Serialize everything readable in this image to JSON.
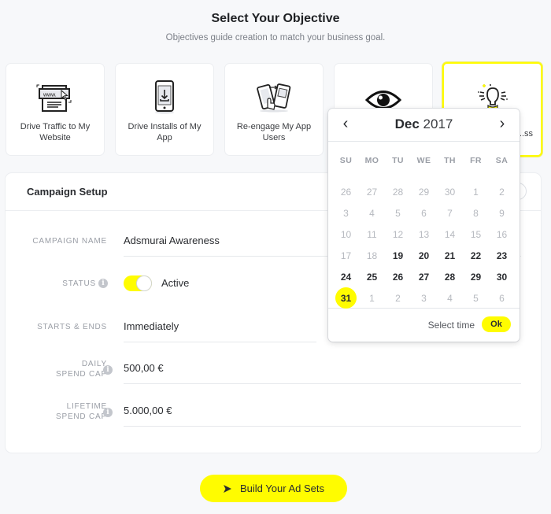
{
  "header": {
    "title": "Select Your Objective",
    "subtitle": "Objectives guide creation to match your business goal."
  },
  "objectives": [
    {
      "label": "Drive Traffic to My Website",
      "icon": "website-icon",
      "selected": false
    },
    {
      "label": "Drive Installs of My App",
      "icon": "app-install-icon",
      "selected": false
    },
    {
      "label": "Re-engage My App Users",
      "icon": "app-reengage-icon",
      "selected": false
    },
    {
      "label": "",
      "icon": "eye-icon",
      "selected": false
    },
    {
      "label": "...ss",
      "icon": "awareness-icon",
      "selected": true
    }
  ],
  "campaign_setup": {
    "title": "Campaign Setup",
    "fields": {
      "campaign_name": {
        "label": "CAMPAIGN NAME",
        "value": "Adsmurai Awareness"
      },
      "status": {
        "label": "STATUS",
        "value": "Active",
        "on": true
      },
      "starts_ends": {
        "label": "STARTS & ENDS",
        "value": "Immediately"
      },
      "daily_spend_cap": {
        "label_line1": "DAILY",
        "label_line2": "SPEND CAP",
        "value": "500,00 €"
      },
      "lifetime_spend_cap": {
        "label_line1": "LIFETIME",
        "label_line2": "SPEND CAP",
        "value": "5.000,00 €"
      }
    }
  },
  "calendar": {
    "month": "Dec",
    "year": "2017",
    "prev_icon": "‹",
    "next_icon": "›",
    "weekdays": [
      "SU",
      "MO",
      "TU",
      "WE",
      "TH",
      "FR",
      "SA"
    ],
    "weeks": [
      [
        {
          "d": "26",
          "s": "muted"
        },
        {
          "d": "27",
          "s": "muted"
        },
        {
          "d": "28",
          "s": "muted"
        },
        {
          "d": "29",
          "s": "muted"
        },
        {
          "d": "30",
          "s": "muted"
        },
        {
          "d": "1",
          "s": "muted"
        },
        {
          "d": "2",
          "s": "muted"
        }
      ],
      [
        {
          "d": "3",
          "s": "muted"
        },
        {
          "d": "4",
          "s": "muted"
        },
        {
          "d": "5",
          "s": "muted"
        },
        {
          "d": "6",
          "s": "muted"
        },
        {
          "d": "7",
          "s": "muted"
        },
        {
          "d": "8",
          "s": "muted"
        },
        {
          "d": "9",
          "s": "muted"
        }
      ],
      [
        {
          "d": "10",
          "s": "muted"
        },
        {
          "d": "11",
          "s": "muted"
        },
        {
          "d": "12",
          "s": "muted"
        },
        {
          "d": "13",
          "s": "muted"
        },
        {
          "d": "14",
          "s": "muted"
        },
        {
          "d": "15",
          "s": "muted"
        },
        {
          "d": "16",
          "s": "muted"
        }
      ],
      [
        {
          "d": "17",
          "s": "muted"
        },
        {
          "d": "18",
          "s": "muted"
        },
        {
          "d": "19",
          "s": "active"
        },
        {
          "d": "20",
          "s": "active"
        },
        {
          "d": "21",
          "s": "active"
        },
        {
          "d": "22",
          "s": "active"
        },
        {
          "d": "23",
          "s": "active"
        }
      ],
      [
        {
          "d": "24",
          "s": "active"
        },
        {
          "d": "25",
          "s": "active"
        },
        {
          "d": "26",
          "s": "active"
        },
        {
          "d": "27",
          "s": "active"
        },
        {
          "d": "28",
          "s": "active"
        },
        {
          "d": "29",
          "s": "active"
        },
        {
          "d": "30",
          "s": "active"
        }
      ],
      [
        {
          "d": "31",
          "s": "selected"
        },
        {
          "d": "1",
          "s": "muted"
        },
        {
          "d": "2",
          "s": "muted"
        },
        {
          "d": "3",
          "s": "muted"
        },
        {
          "d": "4",
          "s": "muted"
        },
        {
          "d": "5",
          "s": "muted"
        },
        {
          "d": "6",
          "s": "muted"
        }
      ]
    ],
    "select_time_label": "Select time",
    "ok_label": "Ok"
  },
  "footer": {
    "build_button_label": "Build Your Ad Sets"
  },
  "colors": {
    "accent": "#fffc00",
    "background": "#f7f8fa"
  }
}
